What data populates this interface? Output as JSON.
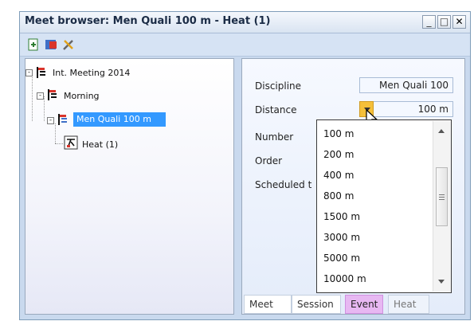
{
  "window": {
    "title": "Meet browser: Men Quali 100 m - Heat (1)",
    "controls": [
      "_",
      "□",
      "✕"
    ]
  },
  "toolbar": {
    "icons": [
      "add-icon",
      "remove-icon",
      "tools-icon"
    ]
  },
  "tree": {
    "nodes": [
      {
        "label": "Int. Meeting  2014",
        "expander": "-"
      },
      {
        "label": "Morning",
        "expander": "-"
      },
      {
        "label": "Men Quali 100 m",
        "expander": "-"
      },
      {
        "label": "Heat (1)"
      }
    ]
  },
  "details": {
    "labels": {
      "discipline": "Discipline",
      "distance": "Distance",
      "number": "Number",
      "order": "Order",
      "scheduled": "Scheduled t"
    },
    "values": {
      "discipline": "Men Quali 100",
      "distance": "100 m"
    }
  },
  "dropdown": {
    "options": [
      "100 m",
      "200 m",
      "400 m",
      "800 m",
      "1500 m",
      "3000 m",
      "5000 m",
      "10000 m"
    ]
  },
  "tabs": [
    {
      "label": "Meet"
    },
    {
      "label": "Session"
    },
    {
      "label": "Event"
    },
    {
      "label": "Heat"
    }
  ]
}
